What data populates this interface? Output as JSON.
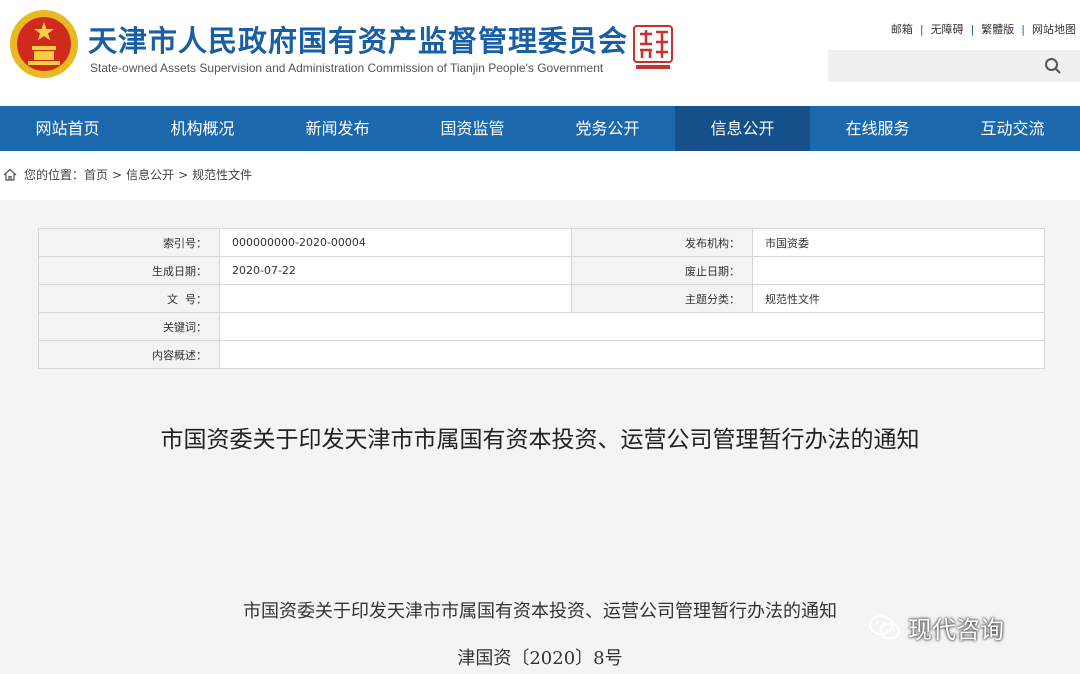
{
  "header": {
    "title": "天津市人民政府国有资产监督管理委员会",
    "subtitle": "State-owned Assets Supervision and Administration Commission of Tianjin People's Government",
    "top_links": [
      "邮箱",
      "无障碍",
      "繁體版",
      "网站地图"
    ],
    "search": {
      "placeholder": ""
    }
  },
  "nav": {
    "items": [
      "网站首页",
      "机构概况",
      "新闻发布",
      "国资监管",
      "党务公开",
      "信息公开",
      "在线服务",
      "互动交流"
    ],
    "active": "信息公开"
  },
  "breadcrumb": {
    "prefix": "您的位置：",
    "items": [
      "首页",
      "信息公开",
      "规范性文件"
    ]
  },
  "meta_table": {
    "index_label": "索引号：",
    "index_value": "000000000-2020-00004",
    "issuer_label": "发布机构：",
    "issuer_value": "市国资委",
    "date_label": "生成日期：",
    "date_value": "2020-07-22",
    "repeal_label": "废止日期：",
    "repeal_value": "",
    "docno_label": "文  号：",
    "docno_value": "",
    "topic_label": "主题分类：",
    "topic_value": "规范性文件",
    "keywords_label": "关键词：",
    "keywords_value": "",
    "summary_label": "内容概述：",
    "summary_value": ""
  },
  "document": {
    "title": "市国资委关于印发天津市市属国有资本投资、运营公司管理暂行办法的通知",
    "subtitle": "市国资委关于印发天津市市属国有资本投资、运营公司管理暂行办法的通知",
    "number": "津国资〔2020〕8号"
  },
  "watermark": {
    "text": "现代咨询"
  },
  "colors": {
    "brand": "#1a5ea6",
    "nav_bg": "#1b68ad",
    "nav_active": "#15508a"
  }
}
